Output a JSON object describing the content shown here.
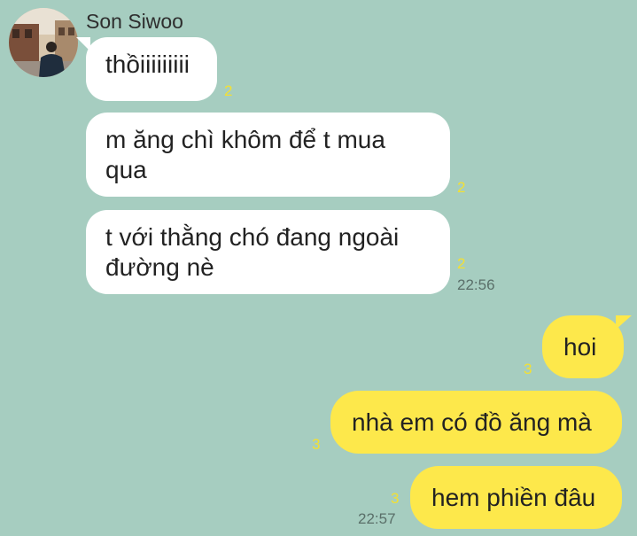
{
  "chat": {
    "sender_name": "Son Siwoo",
    "incoming": [
      {
        "text": "thồiiiiiiiii",
        "unread": "2"
      },
      {
        "text": "m ăng chì khôm để t mua qua",
        "unread": "2"
      },
      {
        "text": "t với thằng chó đang ngoài đường nè",
        "unread": "2",
        "time": "22:56"
      }
    ],
    "outgoing": [
      {
        "text": "hoi",
        "unread": "3"
      },
      {
        "text": "nhà em có đồ ăng mà",
        "unread": "3"
      },
      {
        "text": "hem phiền đâu",
        "unread": "3",
        "time": "22:57"
      }
    ]
  },
  "colors": {
    "background": "#a6cdc0",
    "incoming_bubble": "#ffffff",
    "outgoing_bubble": "#fde84b",
    "unread_count": "#f3e033",
    "timestamp": "#5a6f69"
  }
}
